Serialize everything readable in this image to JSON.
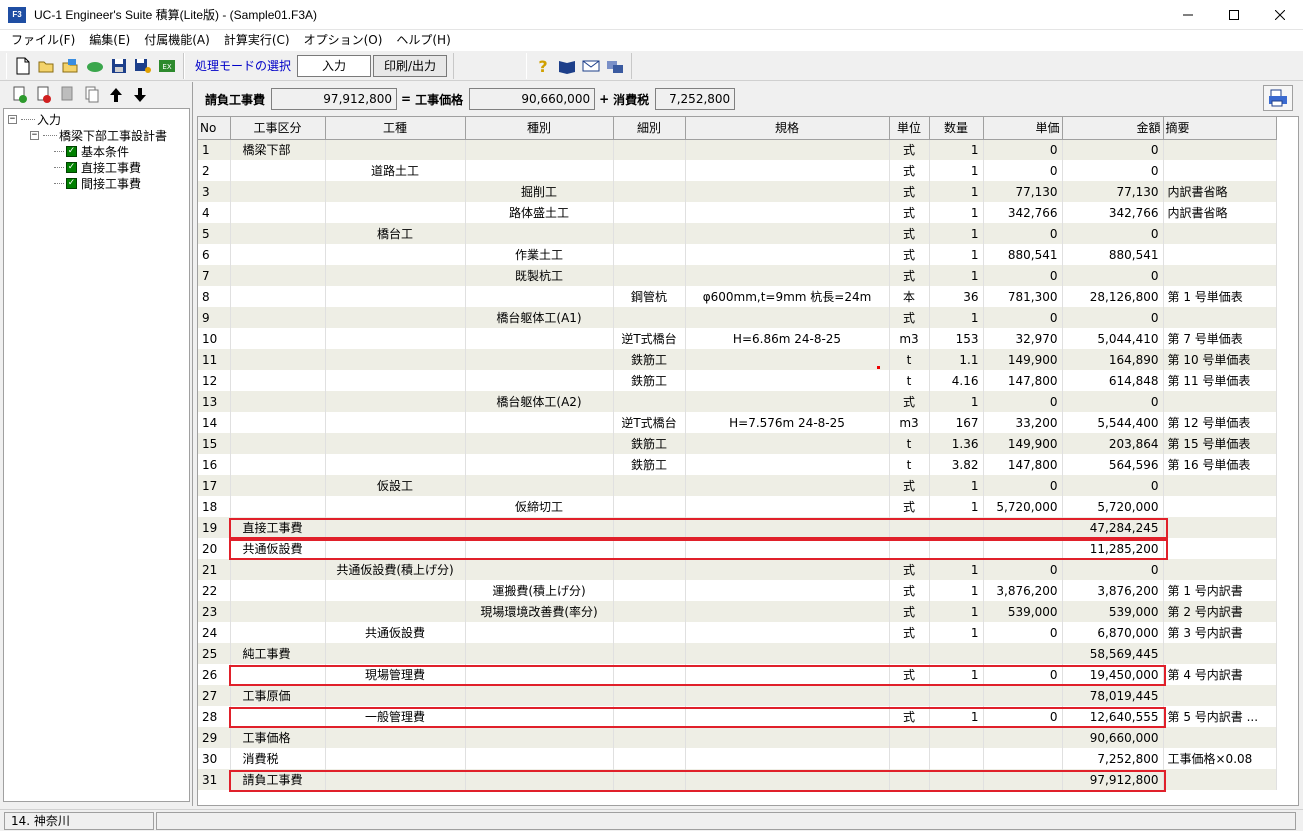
{
  "window": {
    "title": "UC-1 Engineer's Suite 積算(Lite版) - (Sample01.F3A)",
    "app_icon_text": "F3"
  },
  "menu": [
    "ファイル(F)",
    "編集(E)",
    "付属機能(A)",
    "計算実行(C)",
    "オプション(O)",
    "ヘルプ(H)"
  ],
  "toolbar": {
    "mode_label": "処理モードの選択",
    "input_label": "入力",
    "print_label": "印刷/出力"
  },
  "tree": {
    "root": "入力",
    "doc": "橋梁下部工事設計書",
    "items": [
      "基本条件",
      "直接工事費",
      "間接工事費"
    ]
  },
  "summary": {
    "contract_label": "請負工事費",
    "contract_value": "97,912,800",
    "eq": "=",
    "price_label": "工事価格",
    "price_value": "90,660,000",
    "plus": "+",
    "tax_label": "消費税",
    "tax_value": "7,252,800"
  },
  "table": {
    "columns": [
      "No",
      "工事区分",
      "工種",
      "種別",
      "細別",
      "規格",
      "単位",
      "数量",
      "単価",
      "金額",
      "摘要"
    ],
    "rows": [
      [
        "1",
        "橋梁下部",
        "",
        "",
        "",
        "",
        "式",
        "1",
        "0",
        "0",
        ""
      ],
      [
        "2",
        "",
        "道路土工",
        "",
        "",
        "",
        "式",
        "1",
        "0",
        "0",
        ""
      ],
      [
        "3",
        "",
        "",
        "掘削工",
        "",
        "",
        "式",
        "1",
        "77,130",
        "77,130",
        "内訳書省略"
      ],
      [
        "4",
        "",
        "",
        "路体盛土工",
        "",
        "",
        "式",
        "1",
        "342,766",
        "342,766",
        "内訳書省略"
      ],
      [
        "5",
        "",
        "橋台工",
        "",
        "",
        "",
        "式",
        "1",
        "0",
        "0",
        ""
      ],
      [
        "6",
        "",
        "",
        "作業土工",
        "",
        "",
        "式",
        "1",
        "880,541",
        "880,541",
        ""
      ],
      [
        "7",
        "",
        "",
        "既製杭工",
        "",
        "",
        "式",
        "1",
        "0",
        "0",
        ""
      ],
      [
        "8",
        "",
        "",
        "",
        "鋼管杭",
        "φ600mm,t=9mm 杭長=24m",
        "本",
        "36",
        "781,300",
        "28,126,800",
        "第 1 号単価表"
      ],
      [
        "9",
        "",
        "",
        "橋台躯体工(A1)",
        "",
        "",
        "式",
        "1",
        "0",
        "0",
        ""
      ],
      [
        "10",
        "",
        "",
        "",
        "逆T式橋台",
        "H=6.86m 24-8-25",
        "m3",
        "153",
        "32,970",
        "5,044,410",
        "第 7 号単価表"
      ],
      [
        "11",
        "",
        "",
        "",
        "鉄筋工",
        "",
        "t",
        "1.1",
        "149,900",
        "164,890",
        "第 10 号単価表"
      ],
      [
        "12",
        "",
        "",
        "",
        "鉄筋工",
        "",
        "t",
        "4.16",
        "147,800",
        "614,848",
        "第 11 号単価表"
      ],
      [
        "13",
        "",
        "",
        "橋台躯体工(A2)",
        "",
        "",
        "式",
        "1",
        "0",
        "0",
        ""
      ],
      [
        "14",
        "",
        "",
        "",
        "逆T式橋台",
        "H=7.576m 24-8-25",
        "m3",
        "167",
        "33,200",
        "5,544,400",
        "第 12 号単価表"
      ],
      [
        "15",
        "",
        "",
        "",
        "鉄筋工",
        "",
        "t",
        "1.36",
        "149,900",
        "203,864",
        "第 15 号単価表"
      ],
      [
        "16",
        "",
        "",
        "",
        "鉄筋工",
        "",
        "t",
        "3.82",
        "147,800",
        "564,596",
        "第 16 号単価表"
      ],
      [
        "17",
        "",
        "仮設工",
        "",
        "",
        "",
        "式",
        "1",
        "0",
        "0",
        ""
      ],
      [
        "18",
        "",
        "",
        "仮締切工",
        "",
        "",
        "式",
        "1",
        "5,720,000",
        "5,720,000",
        ""
      ],
      [
        "19",
        "直接工事費",
        "",
        "",
        "",
        "",
        "",
        "",
        "",
        "47,284,245",
        ""
      ],
      [
        "20",
        "共通仮設費",
        "",
        "",
        "",
        "",
        "",
        "",
        "",
        "11,285,200",
        ""
      ],
      [
        "21",
        "",
        "共通仮設費(積上げ分)",
        "",
        "",
        "",
        "式",
        "1",
        "0",
        "0",
        ""
      ],
      [
        "22",
        "",
        "",
        "運搬費(積上げ分)",
        "",
        "",
        "式",
        "1",
        "3,876,200",
        "3,876,200",
        "第 1 号内訳書"
      ],
      [
        "23",
        "",
        "",
        "現場環境改善費(率分)",
        "",
        "",
        "式",
        "1",
        "539,000",
        "539,000",
        "第 2 号内訳書"
      ],
      [
        "24",
        "",
        "共通仮設費",
        "",
        "",
        "",
        "式",
        "1",
        "0",
        "6,870,000",
        "第 3 号内訳書"
      ],
      [
        "25",
        "純工事費",
        "",
        "",
        "",
        "",
        "",
        "",
        "",
        "58,569,445",
        ""
      ],
      [
        "26",
        "",
        "現場管理費",
        "",
        "",
        "",
        "式",
        "1",
        "0",
        "19,450,000",
        "第 4 号内訳書"
      ],
      [
        "27",
        "工事原価",
        "",
        "",
        "",
        "",
        "",
        "",
        "",
        "78,019,445",
        ""
      ],
      [
        "28",
        "",
        "一般管理費",
        "",
        "",
        "",
        "式",
        "1",
        "0",
        "12,640,555",
        "第 5 号内訳書 ..."
      ],
      [
        "29",
        "工事価格",
        "",
        "",
        "",
        "",
        "",
        "",
        "",
        "90,660,000",
        ""
      ],
      [
        "30",
        "消費税",
        "",
        "",
        "",
        "",
        "",
        "",
        "",
        "7,252,800",
        "工事価格×0.08"
      ],
      [
        "31",
        "請負工事費",
        "",
        "",
        "",
        "",
        "",
        "",
        "",
        "97,912,800",
        ""
      ]
    ]
  },
  "status": {
    "region": "14.  神奈川"
  },
  "colors": {
    "highlight": "#e0202a",
    "stripe": "#eeeee5",
    "mode_label": "#0000c8"
  }
}
